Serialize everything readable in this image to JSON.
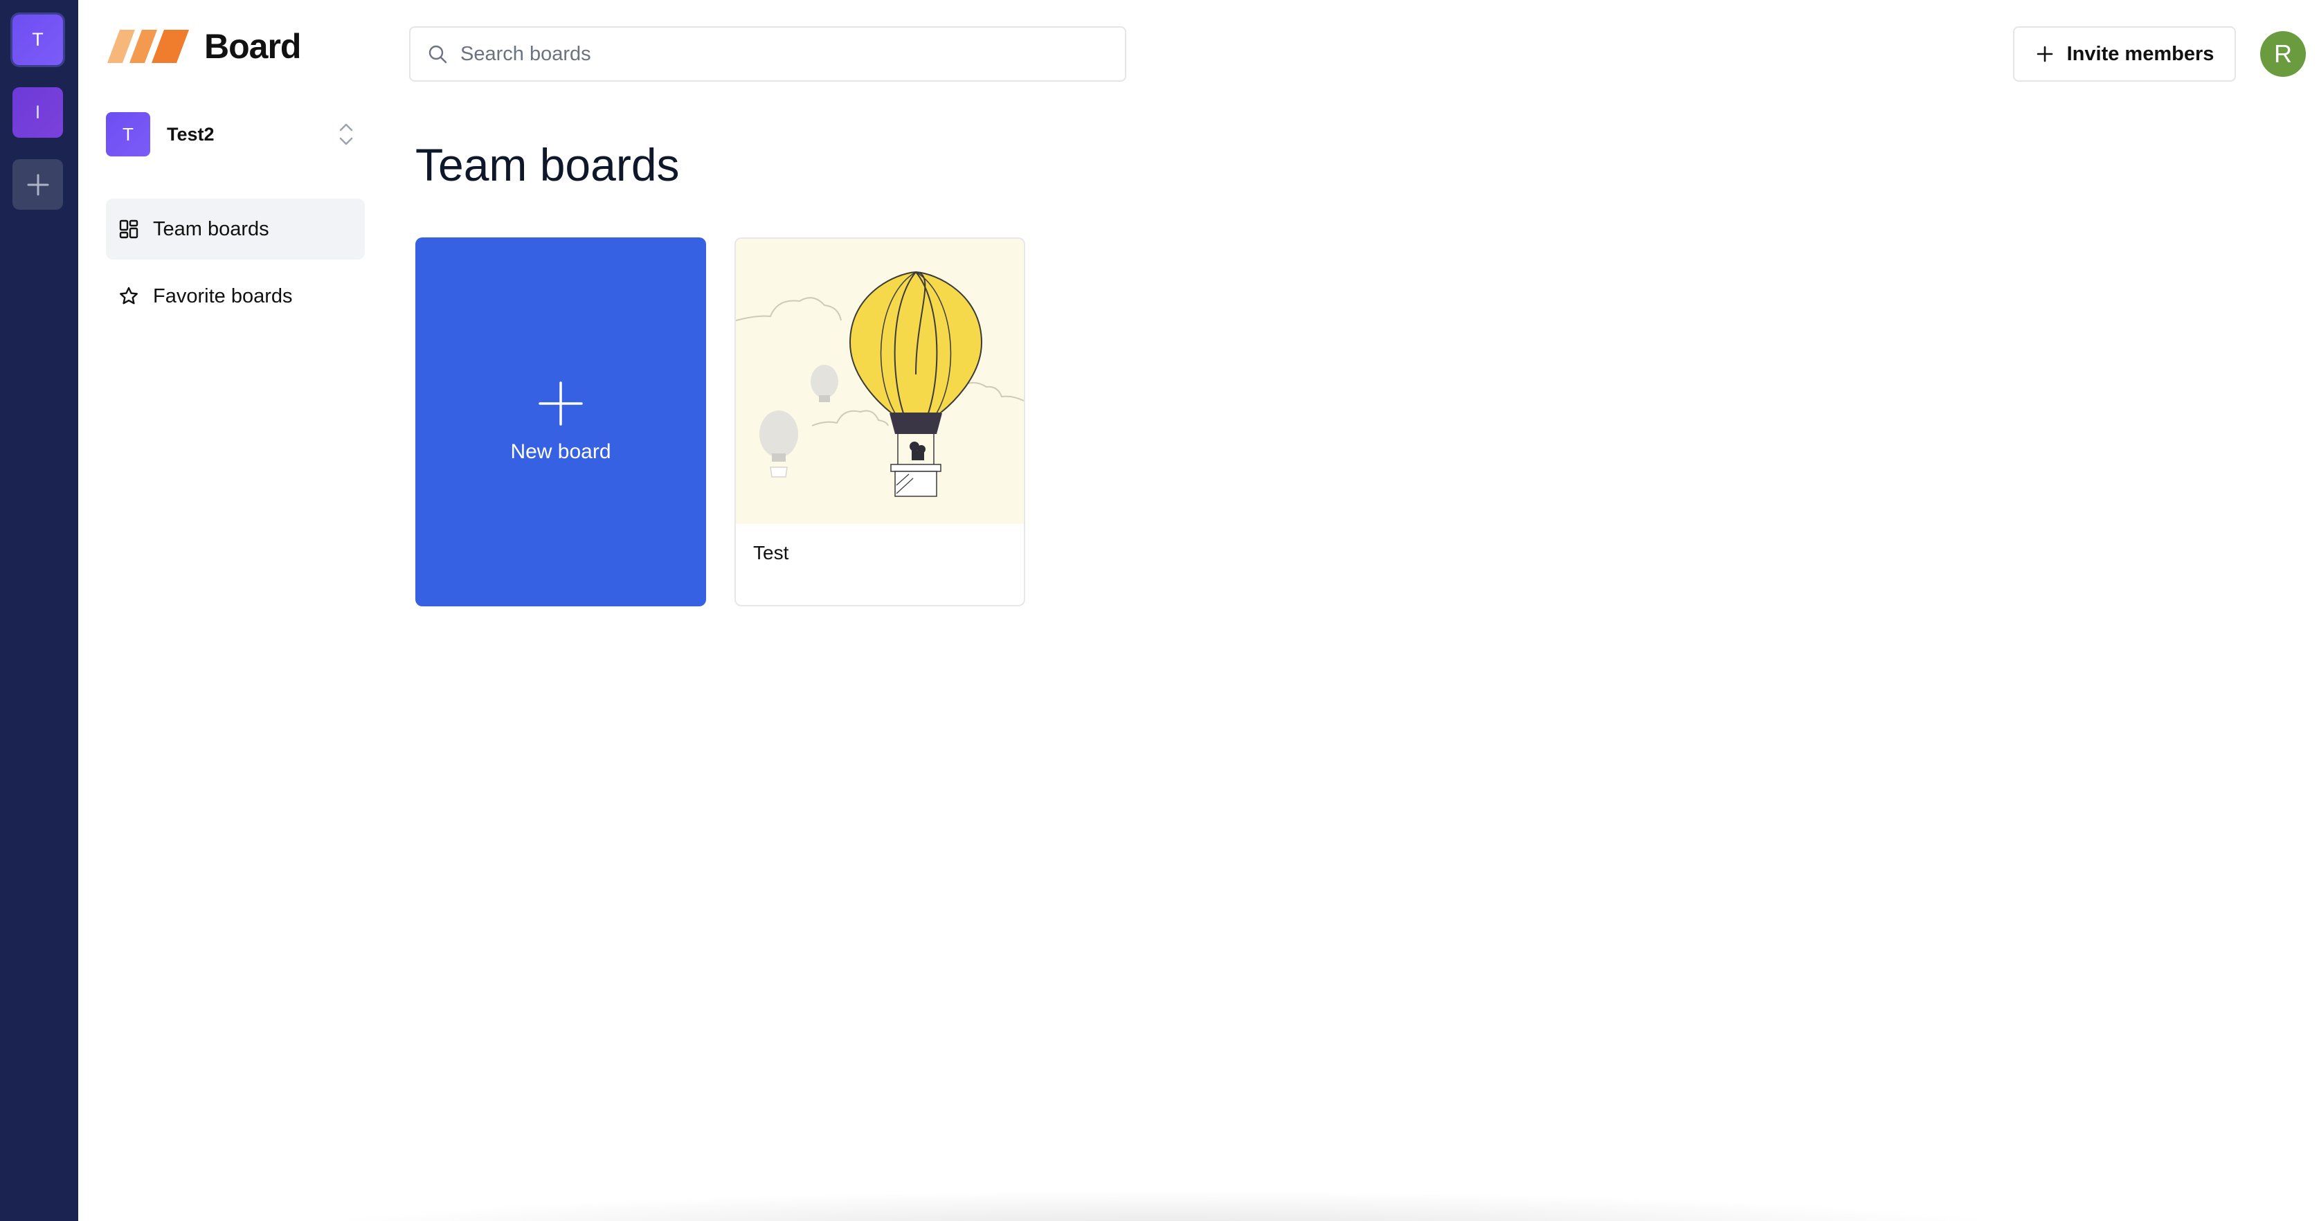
{
  "rail": {
    "orgs": [
      {
        "initial": "T"
      },
      {
        "initial": "I"
      }
    ],
    "add_icon": "plus-icon"
  },
  "sidebar": {
    "logo_text": "Board",
    "org": {
      "initial": "T",
      "name": "Test2"
    },
    "nav": [
      {
        "label": "Team boards",
        "icon": "grid-icon",
        "active": true
      },
      {
        "label": "Favorite boards",
        "icon": "star-icon",
        "active": false
      }
    ]
  },
  "header": {
    "search_placeholder": "Search boards",
    "invite_label": "Invite members",
    "user_initial": "R"
  },
  "main": {
    "title": "Team boards",
    "new_board_label": "New board",
    "boards": [
      {
        "name": "Test",
        "thumbnail": "hot-air-balloon-illustration"
      }
    ]
  },
  "colors": {
    "rail_bg": "#1b2350",
    "accent": "#3661e2",
    "org_purple": "#6d4ef2",
    "user_avatar": "#6a9b3f",
    "thumb_bg": "#fdf9e7",
    "balloon_yellow": "#f5d94a"
  }
}
